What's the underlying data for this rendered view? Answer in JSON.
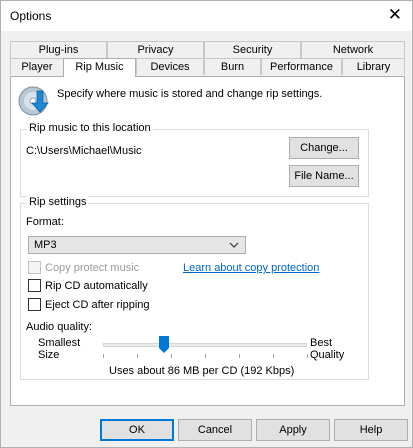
{
  "window": {
    "title": "Options",
    "close_glyph": "✕"
  },
  "tabs_back": [
    "Plug-ins",
    "Privacy",
    "Security",
    "Network"
  ],
  "tabs_front": [
    "Player",
    "Rip Music",
    "Devices",
    "Burn",
    "Performance",
    "Library"
  ],
  "active_tab": "Rip Music",
  "header": {
    "text": "Specify where music is stored and change rip settings.",
    "icon": "cd-download-icon"
  },
  "location": {
    "group_label": "Rip music to this location",
    "path": "C:\\Users\\Michael\\Music",
    "change_button": "Change...",
    "filename_button": "File Name..."
  },
  "settings": {
    "group_label": "Rip settings",
    "format_label": "Format:",
    "format_value": "MP3",
    "copy_protect_label": "Copy protect music",
    "copy_protect_link": "Learn about copy protection",
    "rip_auto_label": "Rip CD automatically",
    "eject_label": "Eject CD after ripping",
    "audio_quality_label": "Audio quality:",
    "smallest_label_1": "Smallest",
    "smallest_label_2": "Size",
    "best_label_1": "Best",
    "best_label_2": "Quality",
    "quality_level": 0.3,
    "quality_text": "Uses about 86 MB per CD (192 Kbps)"
  },
  "buttons": {
    "ok": "OK",
    "cancel": "Cancel",
    "apply": "Apply",
    "help": "Help"
  },
  "colors": {
    "accent": "#0078d7",
    "link": "#0066cc"
  }
}
